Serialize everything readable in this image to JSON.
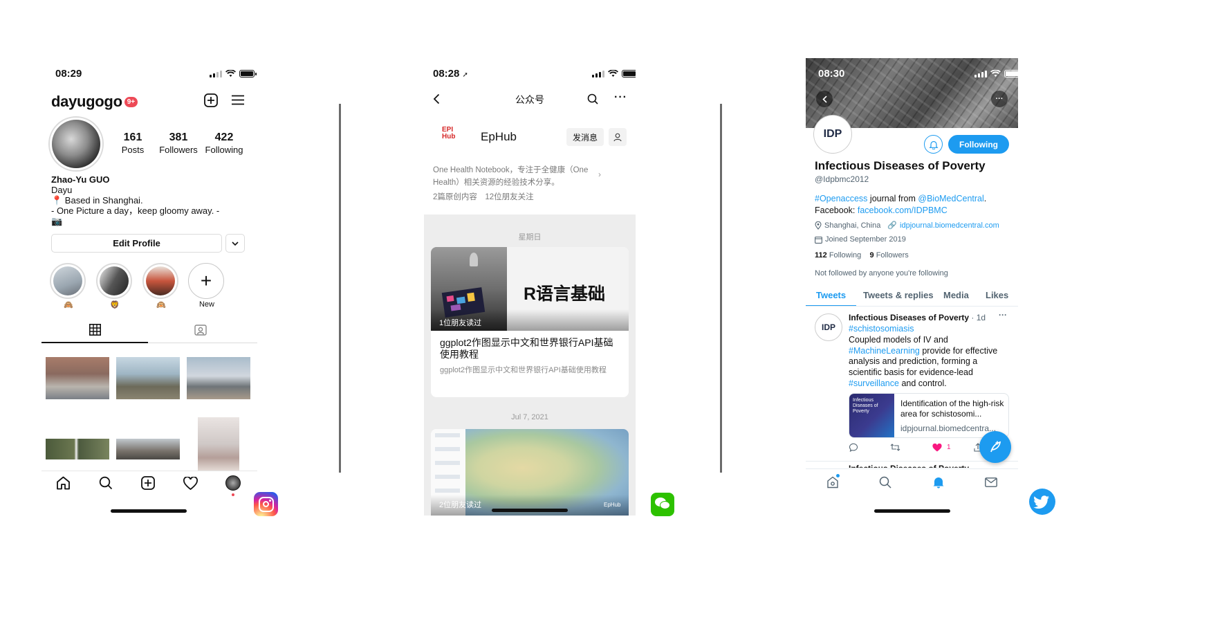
{
  "instagram": {
    "status_time": "08:29",
    "username": "dayugogo",
    "notif_badge": "9+",
    "stats": [
      {
        "value": "161",
        "label": "Posts"
      },
      {
        "value": "381",
        "label": "Followers"
      },
      {
        "value": "422",
        "label": "Following"
      }
    ],
    "name": "Zhao-Yu GUO",
    "bio_line1": "Dayu",
    "bio_line2": "📍 Based in Shanghai.",
    "bio_line3": "- One Picture a day，keep gloomy away. -",
    "bio_line4": "📷",
    "edit_profile": "Edit Profile",
    "stories": [
      {
        "label": "🙈"
      },
      {
        "label": "🦁"
      },
      {
        "label": "🙉"
      },
      {
        "label": "New"
      }
    ],
    "icons": [
      "new-post-icon",
      "menu-icon",
      "grid-icon",
      "tagged-icon",
      "home-icon",
      "search-icon",
      "add-icon",
      "heart-icon"
    ],
    "accent": "#ed4956"
  },
  "wechat": {
    "status_time": "08:28",
    "title": "公众号",
    "account_name": "EpHub",
    "send_message": "发消息",
    "description": "One Health Notebook，专注于全健康（One Health）相关资源的经验技术分享。",
    "counts": "2篇原创内容　12位朋友关注",
    "date1": "星期日",
    "article_banner_text": "R语言基础",
    "article_readers": "1位朋友读过",
    "article_title": "ggplot2作图显示中文和世界银行API基础使用教程",
    "article_summary": "ggplot2作图显示中文和世界银行API基础使用教程",
    "date2": "Jul 7, 2021",
    "article2_readers": "2位朋友读过",
    "article2_watermark": "EpHub",
    "logo_text": "EPI Hub"
  },
  "twitter": {
    "status_time": "08:30",
    "avatar_text": "IDP",
    "following_button": "Following",
    "display_name": "Infectious Diseases of Poverty",
    "handle": "@Idpbmc2012",
    "bio_tag": "#Openaccess",
    "bio_mid": " journal from ",
    "bio_mention": "@BioMedCentral",
    "bio_end": ".",
    "bio_fb_label": "Facebook: ",
    "bio_fb_link": "facebook.com/IDPBMC",
    "location": "Shanghai, China",
    "website": "idpjournal.biomedcentral.com",
    "joined": "Joined September 2019",
    "following_count": "112",
    "following_label": "Following",
    "followers_count": "9",
    "followers_label": "Followers",
    "not_followed": "Not followed by anyone you're following",
    "tabs": [
      "Tweets",
      "Tweets & replies",
      "Media",
      "Likes"
    ],
    "tweet": {
      "author": "Infectious Diseases of Poverty",
      "age": "· 1d",
      "hashtag1": "#schistosomiasis",
      "text1": "Coupled models of IV and",
      "hashtag2": "#MachineLearning",
      "text2": " provide for effective",
      "text3": "analysis and prediction, forming a",
      "text4": "scientific basis for evidence-lead",
      "hashtag3": "#surveillance",
      "text5": " and control.",
      "card_thumb": "Infectious Diseases of Poverty",
      "card_title": "Identification of the high-risk area for schistosomi...",
      "card_domain": "idpjournal.biomedcentra...",
      "likes": "1"
    },
    "next_tweet_partial": "Infectious Diseases of Poverty",
    "accent": "#1d9bf0"
  }
}
